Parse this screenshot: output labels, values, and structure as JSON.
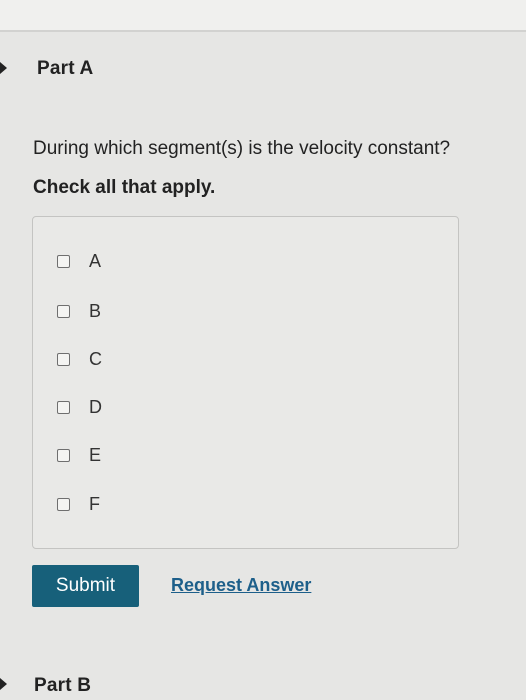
{
  "part_a": {
    "title": "Part A",
    "question": "During which segment(s) is the velocity constant?",
    "instruction": "Check all that apply.",
    "options": [
      {
        "label": "A",
        "checked": false
      },
      {
        "label": "B",
        "checked": false
      },
      {
        "label": "C",
        "checked": false
      },
      {
        "label": "D",
        "checked": false
      },
      {
        "label": "E",
        "checked": false
      },
      {
        "label": "F",
        "checked": false
      }
    ],
    "submit_label": "Submit",
    "request_answer_label": "Request Answer"
  },
  "part_b": {
    "title": "Part B"
  },
  "colors": {
    "submit_bg": "#17607a",
    "link": "#1d5f8a",
    "page_bg": "#e6e6e4"
  }
}
